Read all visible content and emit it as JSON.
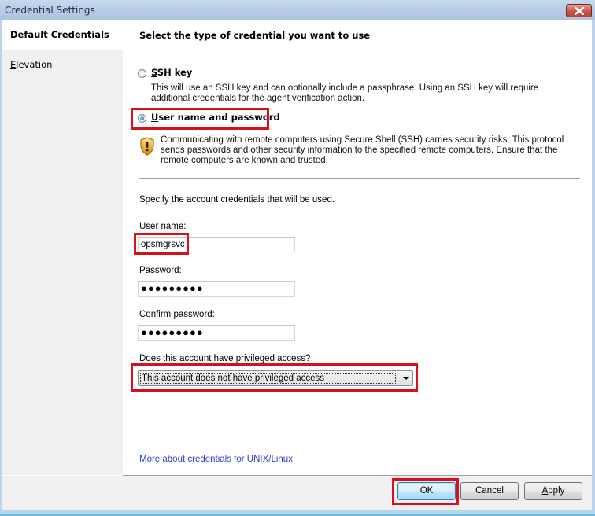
{
  "window": {
    "title": "Credential Settings",
    "close_icon": "close-x-icon"
  },
  "sidebar": {
    "items": [
      {
        "label": "Default Credentials",
        "mnemonic": "D",
        "rest": "efault Credentials",
        "active": true
      },
      {
        "label": "Elevation",
        "mnemonic": "E",
        "rest": "levation",
        "active": false
      }
    ]
  },
  "main": {
    "heading": "Select the type of credential you want to use",
    "options": [
      {
        "label": "SSH key",
        "mnemonic": "S",
        "rest": "SH key",
        "selected": false,
        "description": "This will use an SSH key and can optionally include a passphrase. Using an SSH key will require additional credentials for the agent verification action."
      },
      {
        "label": "User name and password",
        "mnemonic": "U",
        "rest": "ser name and password",
        "selected": true,
        "warning_icon": "security-shield-warning-icon",
        "description": "Communicating with remote computers using Secure Shell (SSH) carries security risks. This protocol sends passwords and other security information to the specified remote computers. Ensure that the remote computers are known and trusted."
      }
    ],
    "credentials_intro": "Specify the account credentials that will be used.",
    "username": {
      "label": "User name:",
      "value": "opsmgrsvc"
    },
    "password": {
      "label": "Password:",
      "masked_value": "●●●●●●●●●"
    },
    "confirm_password": {
      "label": "Confirm password:",
      "masked_value": "●●●●●●●●●"
    },
    "privileged": {
      "label": "Does this account have privileged access?",
      "selected": "This account does not have privileged access"
    },
    "help_link": "More about credentials for UNIX/Linux"
  },
  "footer": {
    "ok_label": "OK",
    "cancel_label": "Cancel",
    "apply_label": "Apply"
  },
  "colors": {
    "highlight": "#d9101a",
    "link": "#2a3fcf",
    "titlebar": "#b7cde6"
  }
}
